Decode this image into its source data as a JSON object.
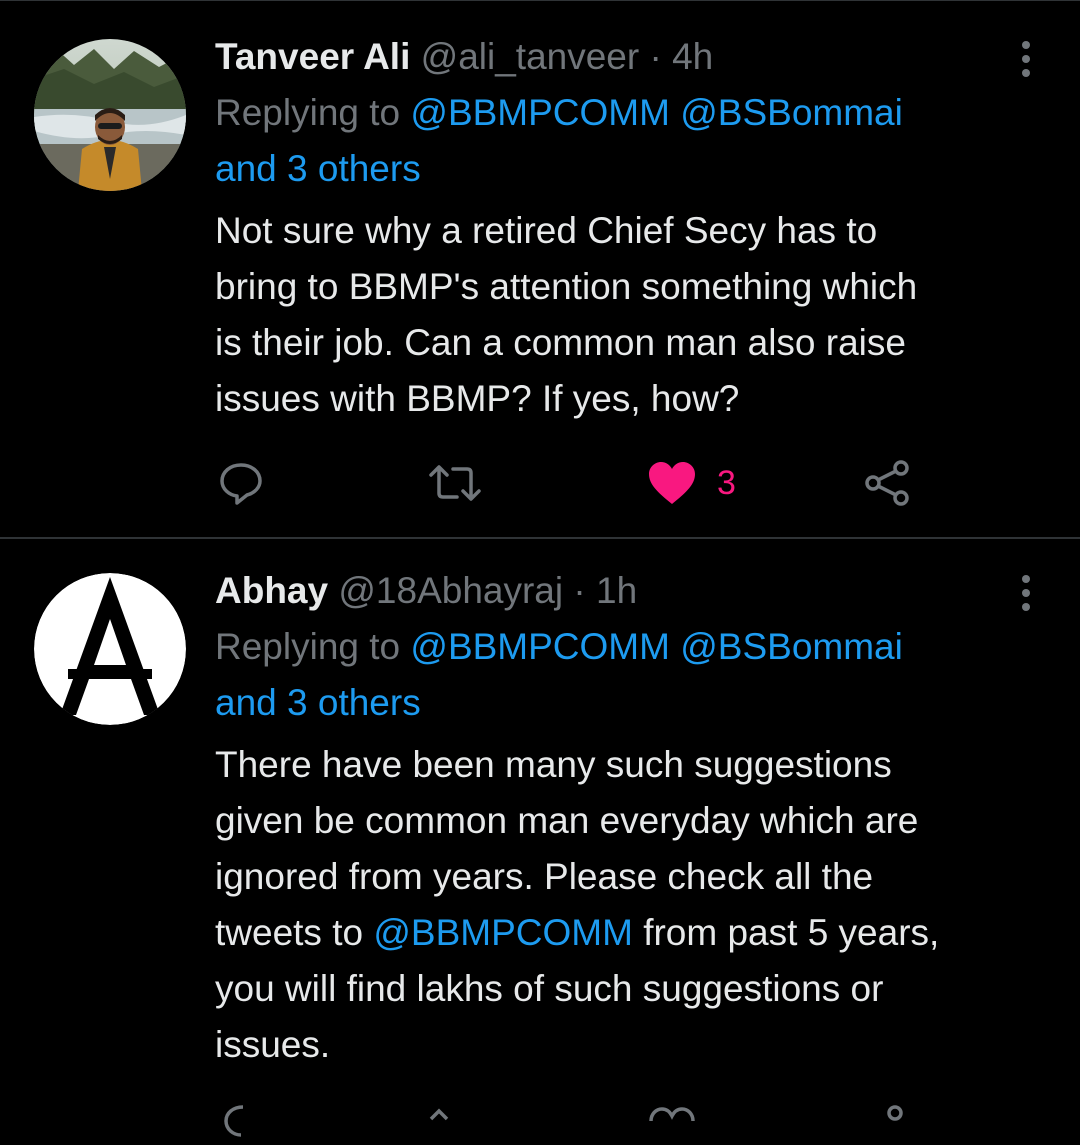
{
  "tweets": [
    {
      "name": "Tanveer Ali",
      "handle": "@ali_tanveer",
      "time": "· 4h",
      "replying_prefix": "Replying to",
      "mention1": "@BBMPCOMM",
      "mention2": "@BSBommai",
      "others": "and 3 others",
      "lines": [
        "Not sure why a retired Chief Secy has to",
        "bring to BBMP's attention something which",
        "is their job. Can a common man also raise",
        "issues with BBMP? If yes, how?"
      ],
      "like_count": "3",
      "liked": true
    },
    {
      "name": "Abhay",
      "handle": "@18Abhayraj",
      "time": "· 1h",
      "replying_prefix": "Replying to",
      "mention1": "@BBMPCOMM",
      "mention2": "@BSBommai",
      "others": "and 3 others",
      "lines": [
        "There have been many such suggestions",
        "given be common man everyday which are",
        "ignored from years. Please check all the"
      ],
      "line4_prefix": "tweets to",
      "line4_mention": "@BBMPCOMM",
      "line4_suffix": "from past 5 years,",
      "lines_after": [
        "you will find lakhs of such suggestions or",
        "issues."
      ]
    }
  ],
  "colors": {
    "background": "#000000",
    "text": "#e7e9ea",
    "muted": "#71767b",
    "link": "#1d9bf0",
    "like": "#f91880",
    "divider": "#2f3336"
  },
  "icons": [
    "reply-icon",
    "retweet-icon",
    "heart-icon",
    "share-icon",
    "more-icon"
  ]
}
